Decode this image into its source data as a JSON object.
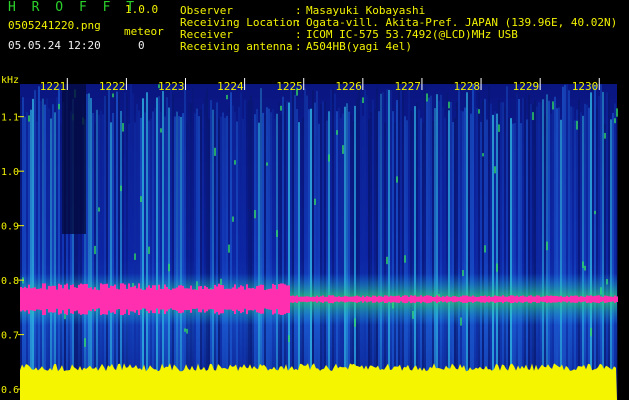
{
  "header": {
    "app_title": "H R O F F T",
    "version": "1.0.0",
    "filename": "0505241220.png",
    "datetime": "05.05.24 12:20",
    "meteor_label": "meteor",
    "meteor_count": "0",
    "info": [
      {
        "label": "Observer",
        "value": "Masayuki Kobayashi"
      },
      {
        "label": "Receiving Location",
        "value": "Ogata-vill. Akita-Pref. JAPAN (139.96E, 40.02N)"
      },
      {
        "label": "Receiver",
        "value": "ICOM IC-575 53.7492(@LCD)MHz USB"
      },
      {
        "label": "Receiving antenna",
        "value": "A504HB(yagi 4el)"
      }
    ],
    "separator": ":"
  },
  "colors": {
    "background": "#000000",
    "header_green": "#2bd12b",
    "header_yellow": "#f2f200",
    "spectrum_low": "#0a1a8c",
    "spectrum_mid": "#2fa0d0",
    "spectrum_high": "#30e060",
    "echo_band": "#ff2fb0",
    "noise_floor": "#f5f500"
  },
  "chart_data": {
    "type": "heatmap",
    "ylabel": "kHz",
    "y_ticks": [
      "1.1",
      "1.0",
      "0.9",
      "0.8",
      "0.7",
      "0.6"
    ],
    "y_tick_values": [
      1.1,
      1.0,
      0.9,
      0.8,
      0.7,
      0.6
    ],
    "ylim": [
      0.58,
      1.16
    ],
    "x_ticks": [
      "1221",
      "1222",
      "1223",
      "1224",
      "1225",
      "1226",
      "1227",
      "1228",
      "1229",
      "1230"
    ],
    "x_tick_values": [
      1221,
      1222,
      1223,
      1224,
      1225,
      1226,
      1227,
      1228,
      1229,
      1230
    ],
    "xlim": [
      1220.2,
      1230.3
    ],
    "carrier_band_khz": 0.765,
    "noise_floor_khz": 0.64,
    "grid": false
  }
}
